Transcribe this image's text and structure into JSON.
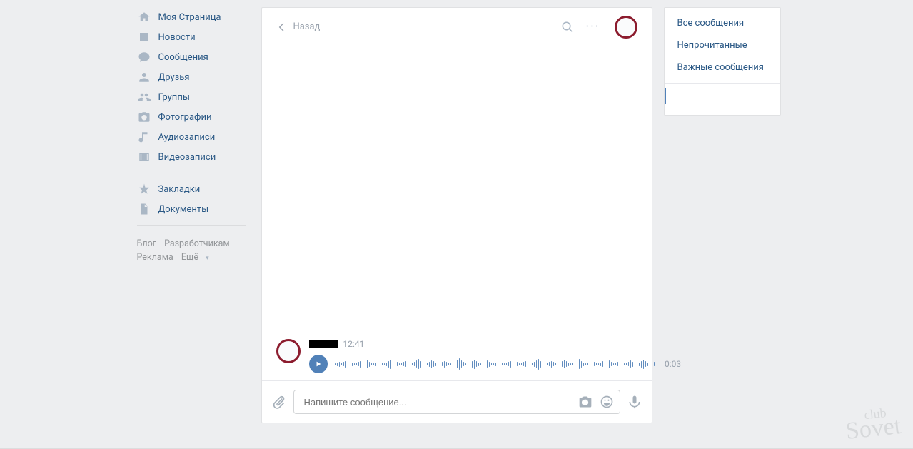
{
  "nav": {
    "items": [
      {
        "label": "Моя Страница",
        "icon": "home-icon"
      },
      {
        "label": "Новости",
        "icon": "news-icon"
      },
      {
        "label": "Сообщения",
        "icon": "messages-icon"
      },
      {
        "label": "Друзья",
        "icon": "friends-icon"
      },
      {
        "label": "Группы",
        "icon": "groups-icon"
      },
      {
        "label": "Фотографии",
        "icon": "photos-icon"
      },
      {
        "label": "Аудиозаписи",
        "icon": "audio-icon"
      },
      {
        "label": "Видеозаписи",
        "icon": "video-icon"
      }
    ],
    "items2": [
      {
        "label": "Закладки",
        "icon": "bookmarks-icon"
      },
      {
        "label": "Документы",
        "icon": "docs-icon"
      }
    ],
    "footer": {
      "blog": "Блог",
      "devs": "Разработчикам",
      "ads": "Реклама",
      "more": "Ещё"
    }
  },
  "dialog": {
    "back": "Назад",
    "title": "",
    "message": {
      "time": "12:41",
      "duration": "0:03"
    },
    "composer": {
      "placeholder": "Напишите сообщение..."
    }
  },
  "side": {
    "all": "Все сообщения",
    "unread": "Непрочитанные",
    "important": "Важные сообщения",
    "active": ""
  },
  "watermark": {
    "top": "club",
    "main": "Sovet"
  }
}
